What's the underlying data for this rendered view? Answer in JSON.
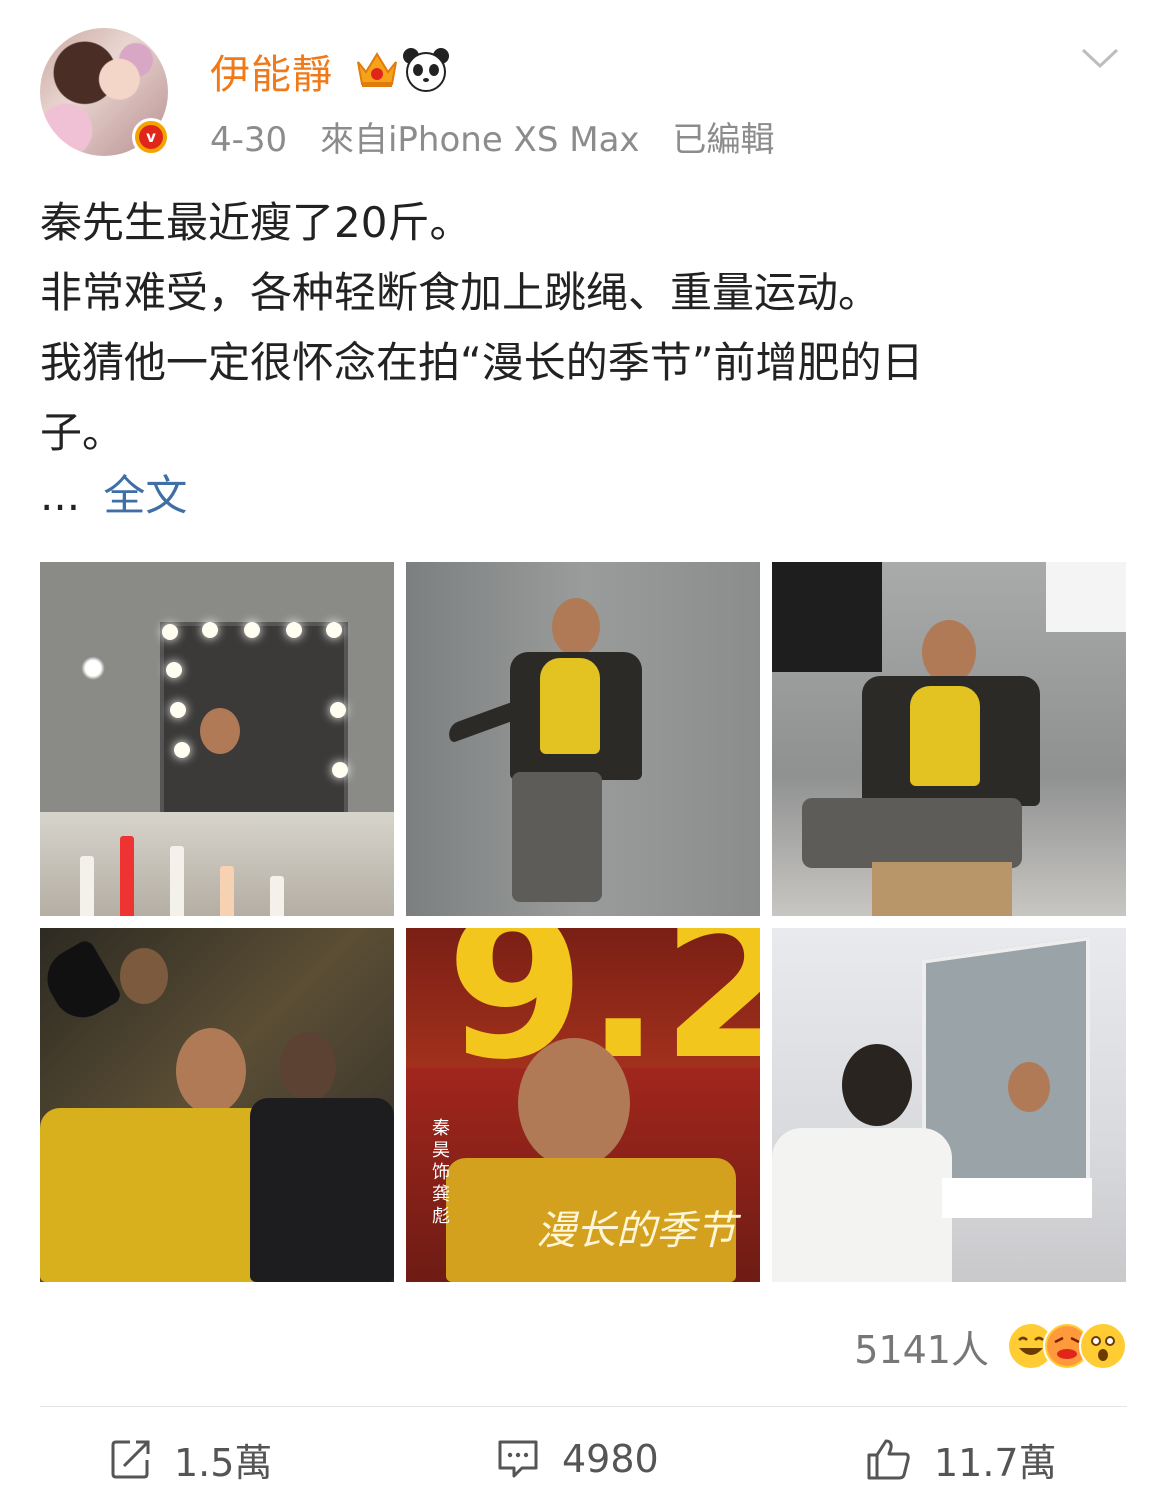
{
  "post": {
    "username": "伊能靜",
    "date": "4-30",
    "source": "來自iPhone XS Max",
    "edited": "已編輯",
    "text_lines": [
      "秦先生最近瘦了20斤。",
      "非常难受，各种轻断食加上跳绳、重量运动。",
      "我猜他一定很怀念在拍“漫长的季节”前增肥的日",
      "子。"
    ],
    "ellipsis": "...",
    "full_text_link": "全文"
  },
  "photos": {
    "poster_number": "9.2",
    "poster_vertical_text": "秦昊 饰 龚彪",
    "poster_title": "漫长的季节"
  },
  "reactions": {
    "count": "5141人"
  },
  "actions": {
    "repost": "1.5萬",
    "comment": "4980",
    "like": "11.7萬"
  },
  "colors": {
    "username": "#f07a1a",
    "link": "#3f6fa6",
    "meta": "#8c8c8c"
  }
}
